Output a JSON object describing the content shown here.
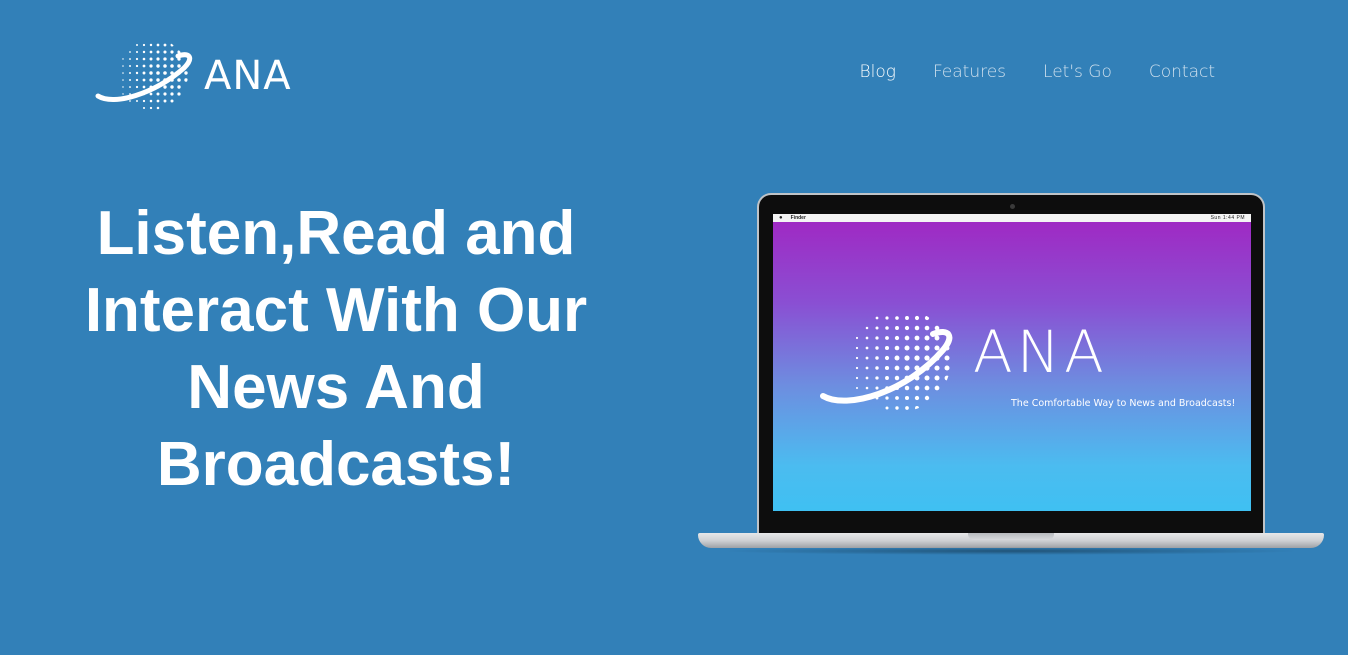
{
  "header": {
    "logo_text": "ANA",
    "logo_icon": "globe-orbit-icon",
    "nav": [
      {
        "label": "Blog",
        "active": true
      },
      {
        "label": "Features",
        "active": false
      },
      {
        "label": "Let's Go",
        "active": false
      },
      {
        "label": "Contact",
        "active": false
      }
    ]
  },
  "hero": {
    "title_lines": [
      "Listen,Read and",
      "Interact With Our",
      "News And",
      "Broadcasts!"
    ]
  },
  "laptop_screen": {
    "menubar_app": "Finder",
    "menubar_status": "Sun 1:44 PM",
    "logo_text": "ANA",
    "tagline": "The Comfortable Way to News and Broadcasts!"
  },
  "colors": {
    "background": "#3280b8",
    "screen_gradient_top": "#a126c2",
    "screen_gradient_bottom": "#3fc0f2"
  }
}
